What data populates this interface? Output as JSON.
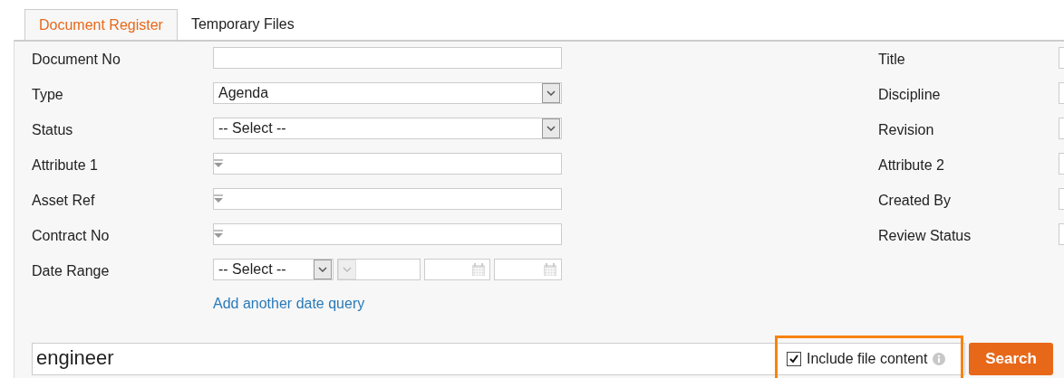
{
  "tabs": [
    {
      "label": "Document Register",
      "selected": true
    },
    {
      "label": "Temporary Files",
      "selected": false
    }
  ],
  "left_fields": [
    {
      "label": "Document No",
      "kind": "text"
    },
    {
      "label": "Type",
      "kind": "select",
      "value": "Agenda"
    },
    {
      "label": "Status",
      "kind": "select",
      "value": "-- Select --"
    },
    {
      "label": "Attribute 1",
      "kind": "combo"
    },
    {
      "label": "Asset Ref",
      "kind": "combo"
    },
    {
      "label": "Contract No",
      "kind": "combo"
    },
    {
      "label": "Date Range",
      "kind": "daterange",
      "value": "-- Select --"
    }
  ],
  "right_fields": [
    {
      "label": "Title"
    },
    {
      "label": "Discipline"
    },
    {
      "label": "Revision"
    },
    {
      "label": "Attribute 2"
    },
    {
      "label": "Created By"
    },
    {
      "label": "Review Status"
    }
  ],
  "date_query_link": "Add another date query",
  "search": {
    "value": "engineer"
  },
  "include_file_content": {
    "label": "Include file content",
    "checked": true,
    "highlighted": true
  },
  "search_button": "Search"
}
